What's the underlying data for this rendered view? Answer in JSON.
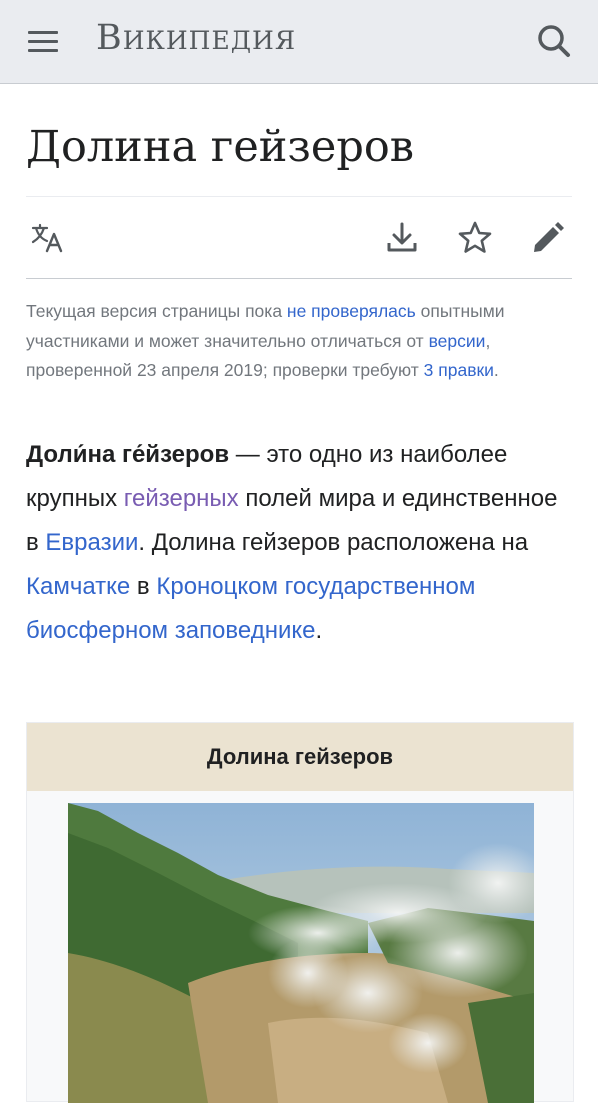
{
  "header": {
    "logo_text": "Википедия",
    "menu_icon": "hamburger-menu-icon",
    "search_icon": "search-icon"
  },
  "article": {
    "title": "Долина гейзеров",
    "actions": [
      {
        "name": "language-button",
        "icon": "translate-icon"
      },
      {
        "name": "download-button",
        "icon": "download-icon"
      },
      {
        "name": "watch-button",
        "icon": "star-icon"
      },
      {
        "name": "edit-button",
        "icon": "pencil-icon"
      }
    ]
  },
  "notice": {
    "text_1": "Текущая версия страницы пока ",
    "link_unreviewed": "не проверялась",
    "text_2": " опытными участниками и может значительно отличаться от ",
    "link_version": "версии",
    "text_3": ", проверенной 23 апреля 2019; проверки требуют ",
    "link_edits": "3 правки",
    "text_4": "."
  },
  "lead": {
    "bold_title": "Доли́на ге́йзеров",
    "text_1": " — это одно из наиболее крупных ",
    "link_geyser": "гейзерных",
    "text_2": " полей мира и единственное в ",
    "link_eurasia": "Евразии",
    "text_3": ". Долина гейзеров расположена на ",
    "link_kamchatka": "Камчатке",
    "text_4": " в ",
    "link_reserve": "Кроноцком государственном биосферном заповеднике",
    "text_5": "."
  },
  "infobox": {
    "title": "Долина гейзеров",
    "image_alt": "valley-with-geysers-photo"
  },
  "colors": {
    "header_bg": "#eaecf0",
    "link": "#3366cc",
    "visited_link": "#795cb2",
    "infobox_header_bg": "#ebe3d1",
    "notice_text": "#72777d"
  }
}
